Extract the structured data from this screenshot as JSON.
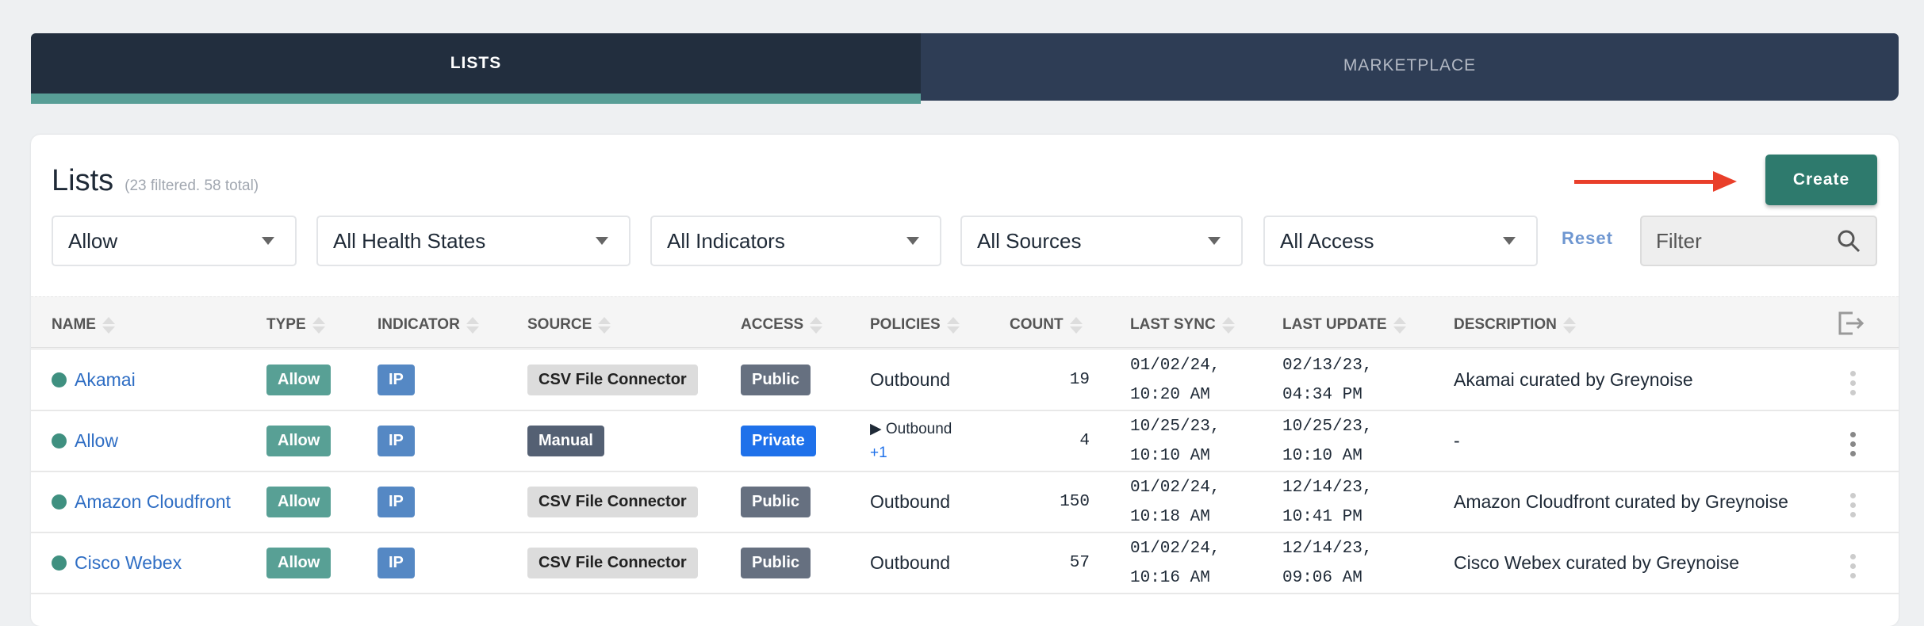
{
  "tabs": [
    {
      "label": "LISTS",
      "active": true
    },
    {
      "label": "MARKETPLACE",
      "active": false
    }
  ],
  "header": {
    "title": "Lists",
    "subtitle": "(23 filtered. 58 total)",
    "create_label": "Create"
  },
  "filters": {
    "type": "Allow",
    "health": "All Health States",
    "indicator": "All Indicators",
    "source": "All Sources",
    "access": "All Access",
    "reset_label": "Reset",
    "search_placeholder": "Filter"
  },
  "columns": [
    "NAME",
    "TYPE",
    "INDICATOR",
    "SOURCE",
    "ACCESS",
    "POLICIES",
    "COUNT",
    "LAST SYNC",
    "LAST UPDATE",
    "DESCRIPTION"
  ],
  "colors": {
    "accent": "#2e7a6d",
    "allow": "#58a095",
    "ip": "#5588c4",
    "csv": "#dcdcdc",
    "manual": "#546073",
    "public": "#667080",
    "private": "#1f71ea"
  },
  "rows": [
    {
      "name": "Akamai",
      "type": "Allow",
      "indicator": "IP",
      "source": "CSV File Connector",
      "access": "Public",
      "policies": "Outbound",
      "policies_extra": "",
      "count": "19",
      "last_sync": [
        "01/02/24,",
        "10:20 AM"
      ],
      "last_update": [
        "02/13/23,",
        "04:34 PM"
      ],
      "description": "Akamai curated by Greynoise"
    },
    {
      "name": "Allow",
      "type": "Allow",
      "indicator": "IP",
      "source": "Manual",
      "access": "Private",
      "policies": "Outbound",
      "policies_extra": "+1",
      "count": "4",
      "last_sync": [
        "10/25/23,",
        "10:10 AM"
      ],
      "last_update": [
        "10/25/23,",
        "10:10 AM"
      ],
      "description": "-"
    },
    {
      "name": "Amazon Cloudfront",
      "type": "Allow",
      "indicator": "IP",
      "source": "CSV File Connector",
      "access": "Public",
      "policies": "Outbound",
      "policies_extra": "",
      "count": "150",
      "last_sync": [
        "01/02/24,",
        "10:18 AM"
      ],
      "last_update": [
        "12/14/23,",
        "10:41 PM"
      ],
      "description": "Amazon Cloudfront curated by Greynoise"
    },
    {
      "name": "Cisco Webex",
      "type": "Allow",
      "indicator": "IP",
      "source": "CSV File Connector",
      "access": "Public",
      "policies": "Outbound",
      "policies_extra": "",
      "count": "57",
      "last_sync": [
        "01/02/24,",
        "10:16 AM"
      ],
      "last_update": [
        "12/14/23,",
        "09:06 AM"
      ],
      "description": "Cisco Webex curated by Greynoise"
    }
  ]
}
